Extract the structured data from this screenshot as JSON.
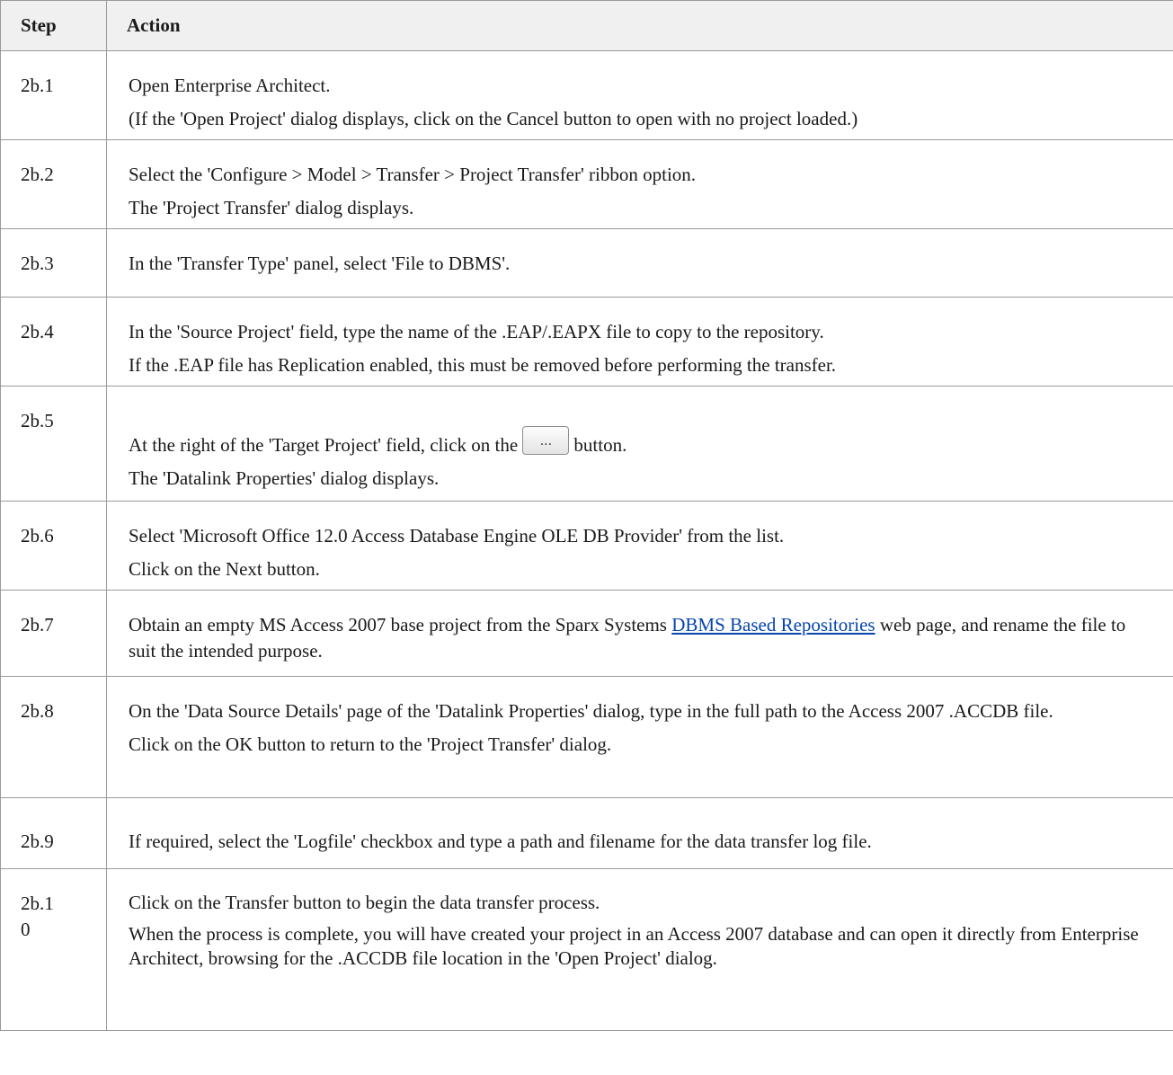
{
  "headers": {
    "step": "Step",
    "action": "Action"
  },
  "rows": [
    {
      "step": "2b.1",
      "lines": [
        "Open Enterprise Architect.",
        "(If the 'Open Project' dialog displays, click on the Cancel button to open with no project loaded.)"
      ]
    },
    {
      "step": "2b.2",
      "lines": [
        "Select the 'Configure > Model > Transfer > Project Transfer' ribbon option.",
        "The 'Project Transfer' dialog displays."
      ]
    },
    {
      "step": "2b.3",
      "lines": [
        "In the 'Transfer Type' panel, select 'File to DBMS'."
      ]
    },
    {
      "step": "2b.4",
      "lines": [
        "In the 'Source Project' field, type the name of the .EAP/.EAPX file to copy to the repository.",
        "If the .EAP file has Replication enabled, this must be removed before performing the transfer."
      ]
    },
    {
      "step": "2b.5",
      "line1_before": "At the right of the 'Target Project' field, click on the",
      "button_icon": "ellipsis-button-icon",
      "button_glyph": "...",
      "line1_after": "button.",
      "line2": "The 'Datalink Properties' dialog displays."
    },
    {
      "step": "2b.6",
      "lines": [
        "Select 'Microsoft Office 12.0 Access Database Engine OLE DB Provider' from the list.",
        "Click on the Next button."
      ]
    },
    {
      "step": "2b.7",
      "text_before": "Obtain an empty MS Access 2007 base project from the Sparx Systems",
      "link": "DBMS Based Repositories",
      "text_after": "web page, and rename the file to suit the intended purpose."
    },
    {
      "step": "2b.8",
      "lines": [
        "On the 'Data Source Details' page of the 'Datalink Properties' dialog, type in the full path to the Access 2007 .ACCDB file.",
        "Click on the OK button to return to the 'Project Transfer' dialog."
      ]
    },
    {
      "step": "2b.9",
      "lines": [
        "If required, select the 'Logfile' checkbox and type a path and filename for the data transfer log file."
      ]
    },
    {
      "step": "2b.10",
      "lines": [
        "Click on the Transfer button to begin the data transfer process.",
        "When the process is complete, you will have created your project in an Access 2007 database and can open it directly from Enterprise Architect, browsing for the .ACCDB file location in the 'Open Project' dialog."
      ]
    }
  ]
}
